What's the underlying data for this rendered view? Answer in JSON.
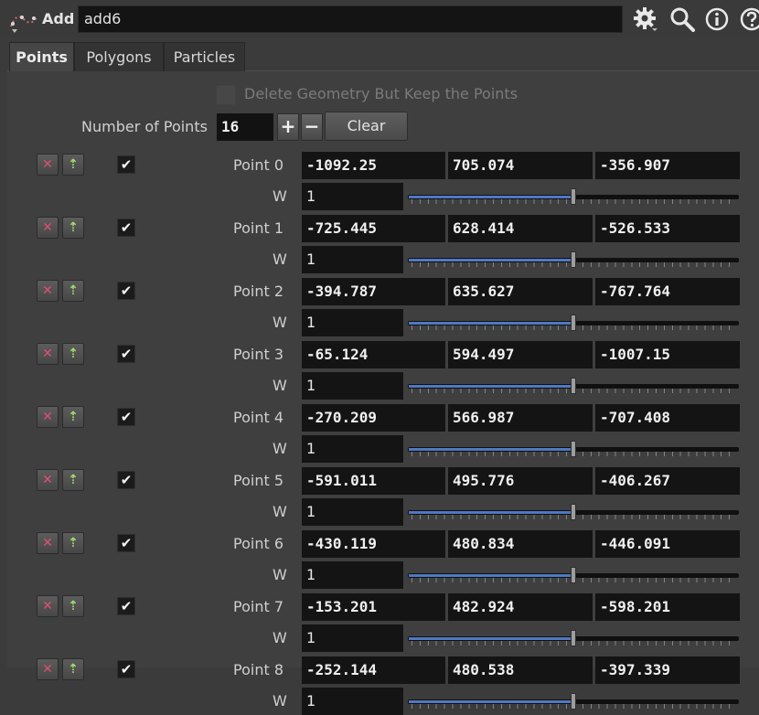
{
  "header": {
    "node_type": "Add",
    "node_name": "add6",
    "icons": [
      "add-node-icon",
      "gear-icon",
      "search-icon",
      "info-icon",
      "help-icon"
    ]
  },
  "tabs": [
    {
      "label": "Points",
      "active": true
    },
    {
      "label": "Polygons",
      "active": false
    },
    {
      "label": "Particles",
      "active": false
    }
  ],
  "controls": {
    "delete_geometry_label": "Delete Geometry But Keep the Points",
    "delete_geometry_checked": false,
    "number_of_points_label": "Number of Points",
    "number_of_points": "16",
    "plus_label": "+",
    "minus_label": "−",
    "clear_label": "Clear"
  },
  "weight_label": "W",
  "points": [
    {
      "label": "Point 0",
      "x": "-1092.25",
      "y": "705.074",
      "z": "-356.907",
      "w": "1",
      "enabled": true
    },
    {
      "label": "Point 1",
      "x": "-725.445",
      "y": "628.414",
      "z": "-526.533",
      "w": "1",
      "enabled": true
    },
    {
      "label": "Point 2",
      "x": "-394.787",
      "y": "635.627",
      "z": "-767.764",
      "w": "1",
      "enabled": true
    },
    {
      "label": "Point 3",
      "x": "-65.124",
      "y": "594.497",
      "z": "-1007.15",
      "w": "1",
      "enabled": true
    },
    {
      "label": "Point 4",
      "x": "-270.209",
      "y": "566.987",
      "z": "-707.408",
      "w": "1",
      "enabled": true
    },
    {
      "label": "Point 5",
      "x": "-591.011",
      "y": "495.776",
      "z": "-406.267",
      "w": "1",
      "enabled": true
    },
    {
      "label": "Point 6",
      "x": "-430.119",
      "y": "480.834",
      "z": "-446.091",
      "w": "1",
      "enabled": true
    },
    {
      "label": "Point 7",
      "x": "-153.201",
      "y": "482.924",
      "z": "-598.201",
      "w": "1",
      "enabled": true
    },
    {
      "label": "Point 8",
      "x": "-252.144",
      "y": "480.538",
      "z": "-397.339",
      "w": "1",
      "enabled": true
    }
  ],
  "weight_slider_fraction": 0.5,
  "colors": {
    "slider_fill": "#4f79c2",
    "delete_icon": "#e05070",
    "insert_icon": "#9fdc6a"
  }
}
